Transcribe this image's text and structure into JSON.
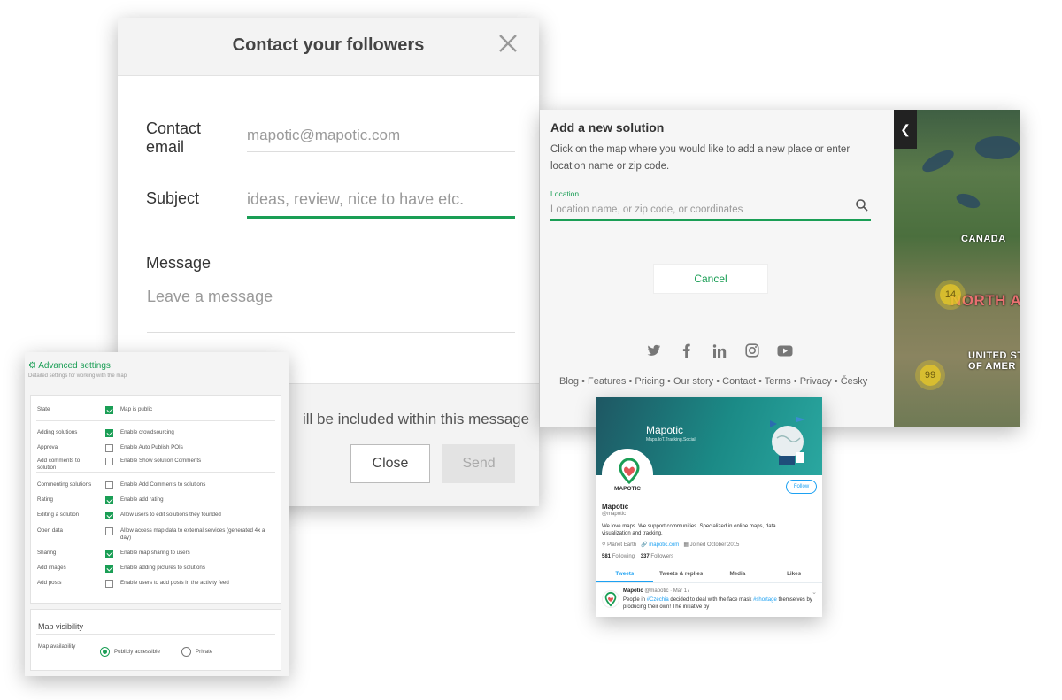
{
  "contact": {
    "title": "Contact your followers",
    "email_label": "Contact email",
    "email_value": "mapotic@mapotic.com",
    "subject_label": "Subject",
    "subject_placeholder": "ideas, review, nice to have etc.",
    "message_label": "Message",
    "message_placeholder": "Leave a message",
    "footer_note": "ill be included within this message",
    "close_button": "Close",
    "send_button": "Send"
  },
  "solution": {
    "title": "Add a new solution",
    "description": "Click on the map where you would like to add a new place or enter location name or zip code.",
    "location_label": "Location",
    "location_placeholder": "Location name, or zip code, or coordinates",
    "cancel_button": "Cancel",
    "social_icons": [
      "twitter-icon",
      "facebook-icon",
      "linkedin-icon",
      "instagram-icon",
      "youtube-icon"
    ],
    "footer_links": "Blog • Features • Pricing • Our story • Contact • Terms • Privacy • Česky",
    "map": {
      "label_canada": "CANADA",
      "label_north_america": "NORTH A",
      "label_us_1": "UNITED ST",
      "label_us_2": "OF AMER",
      "cluster_1": "14",
      "cluster_2": "99"
    }
  },
  "settings": {
    "title": "Advanced settings",
    "subtitle": "Detailed settings for working with the map",
    "rows": [
      {
        "key": "State",
        "value": "Map is public",
        "checked": true
      },
      {
        "key": "Adding solutions",
        "value": "Enable crowdsourcing",
        "checked": true
      },
      {
        "key": "Approval",
        "value": "Enable Auto Publish POIs",
        "checked": false
      },
      {
        "key": "Add comments to solution",
        "value": "Enable Show solution Comments",
        "checked": false
      },
      {
        "key": "Commenting solutions",
        "value": "Enable Add Comments to solutions",
        "checked": false
      },
      {
        "key": "Rating",
        "value": "Enable add rating",
        "checked": true
      },
      {
        "key": "Editing a solution",
        "value": "Allow users to edit solutions they founded",
        "checked": true
      },
      {
        "key": "Open data",
        "value": "Allow access map data to external services (generated 4x a day)",
        "checked": false
      },
      {
        "key": "Sharing",
        "value": "Enable map sharing to users",
        "checked": true
      },
      {
        "key": "Add images",
        "value": "Enable adding pictures to solutions",
        "checked": true
      },
      {
        "key": "Add posts",
        "value": "Enable users to add posts in the activity feed",
        "checked": false
      }
    ],
    "visibility_title": "Map visibility",
    "availability_label": "Map availability",
    "option_public": "Publicly accessible",
    "option_private": "Private"
  },
  "twitter": {
    "banner_name": "Mapotic",
    "banner_tagline": "Maps.IoT.Tracking.Social",
    "avatar_text": "MAPOTIC",
    "follow_button": "Follow",
    "name": "Mapotic",
    "handle": "@mapotic",
    "bio": "We love maps. We support communities. Specialized in online maps, data visualization and tracking.",
    "location": "Planet Earth",
    "website": "mapotic.com",
    "joined": "Joined October 2015",
    "following_count": "581",
    "following_label": "Following",
    "followers_count": "337",
    "followers_label": "Followers",
    "tabs": [
      "Tweets",
      "Tweets & replies",
      "Media",
      "Likes"
    ],
    "tweet": {
      "name": "Mapotic",
      "meta": "@mapotic · Mar 17",
      "text_1": "People in ",
      "tag_1": "#Czechia",
      "text_2": " decided to deal with the face mask ",
      "tag_2": "#shortage",
      "text_3": " themselves by producing their own! The initiative by"
    }
  },
  "colors": {
    "accent": "#1a9e55",
    "twitter_blue": "#1da1f2"
  }
}
